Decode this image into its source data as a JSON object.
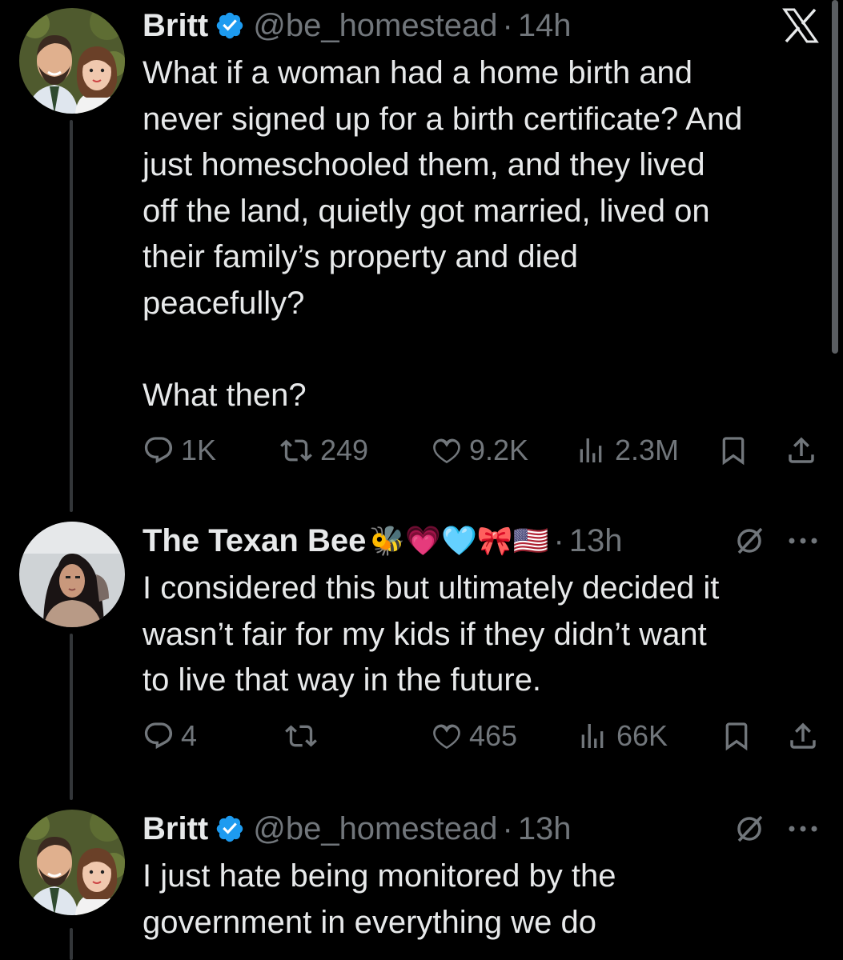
{
  "tweets": [
    {
      "name": "Britt",
      "handle": "@be_homestead",
      "separator": "·",
      "time": "14h",
      "body": "What if a woman had a home birth and\nnever signed up for a birth certificate? And\njust homeschooled them, and they lived\noff the land, quietly got married, lived on\ntheir family’s property and died\npeacefully?\n\nWhat then?",
      "replies": "1K",
      "reposts": "249",
      "likes": "9.2K",
      "views": "2.3M"
    },
    {
      "name": "The Texan Bee",
      "emojis": "🐝💗🩵🎀🇺🇸",
      "separator": "·",
      "time": "13h",
      "body": "I considered this but ultimately decided it\nwasn’t fair for my kids if they didn’t want\nto live that way in the future.",
      "replies": "4",
      "reposts": "",
      "likes": "465",
      "views": "66K"
    },
    {
      "name": "Britt",
      "handle": "@be_homestead",
      "separator": "·",
      "time": "13h",
      "body": "I just hate being monitored by the\ngovernment in everything we do"
    }
  ],
  "icons": {
    "verified": "verified-badge-icon",
    "close": "x-logo-icon",
    "grok": "grok-icon",
    "more": "more-icon",
    "reply": "reply-icon",
    "repost": "repost-icon",
    "like": "like-icon",
    "views": "views-icon",
    "bookmark": "bookmark-icon",
    "share": "share-icon"
  },
  "colors": {
    "background": "#000000",
    "text": "#e7e9ea",
    "secondary": "#71767b",
    "verified": "#1d9bf0"
  }
}
